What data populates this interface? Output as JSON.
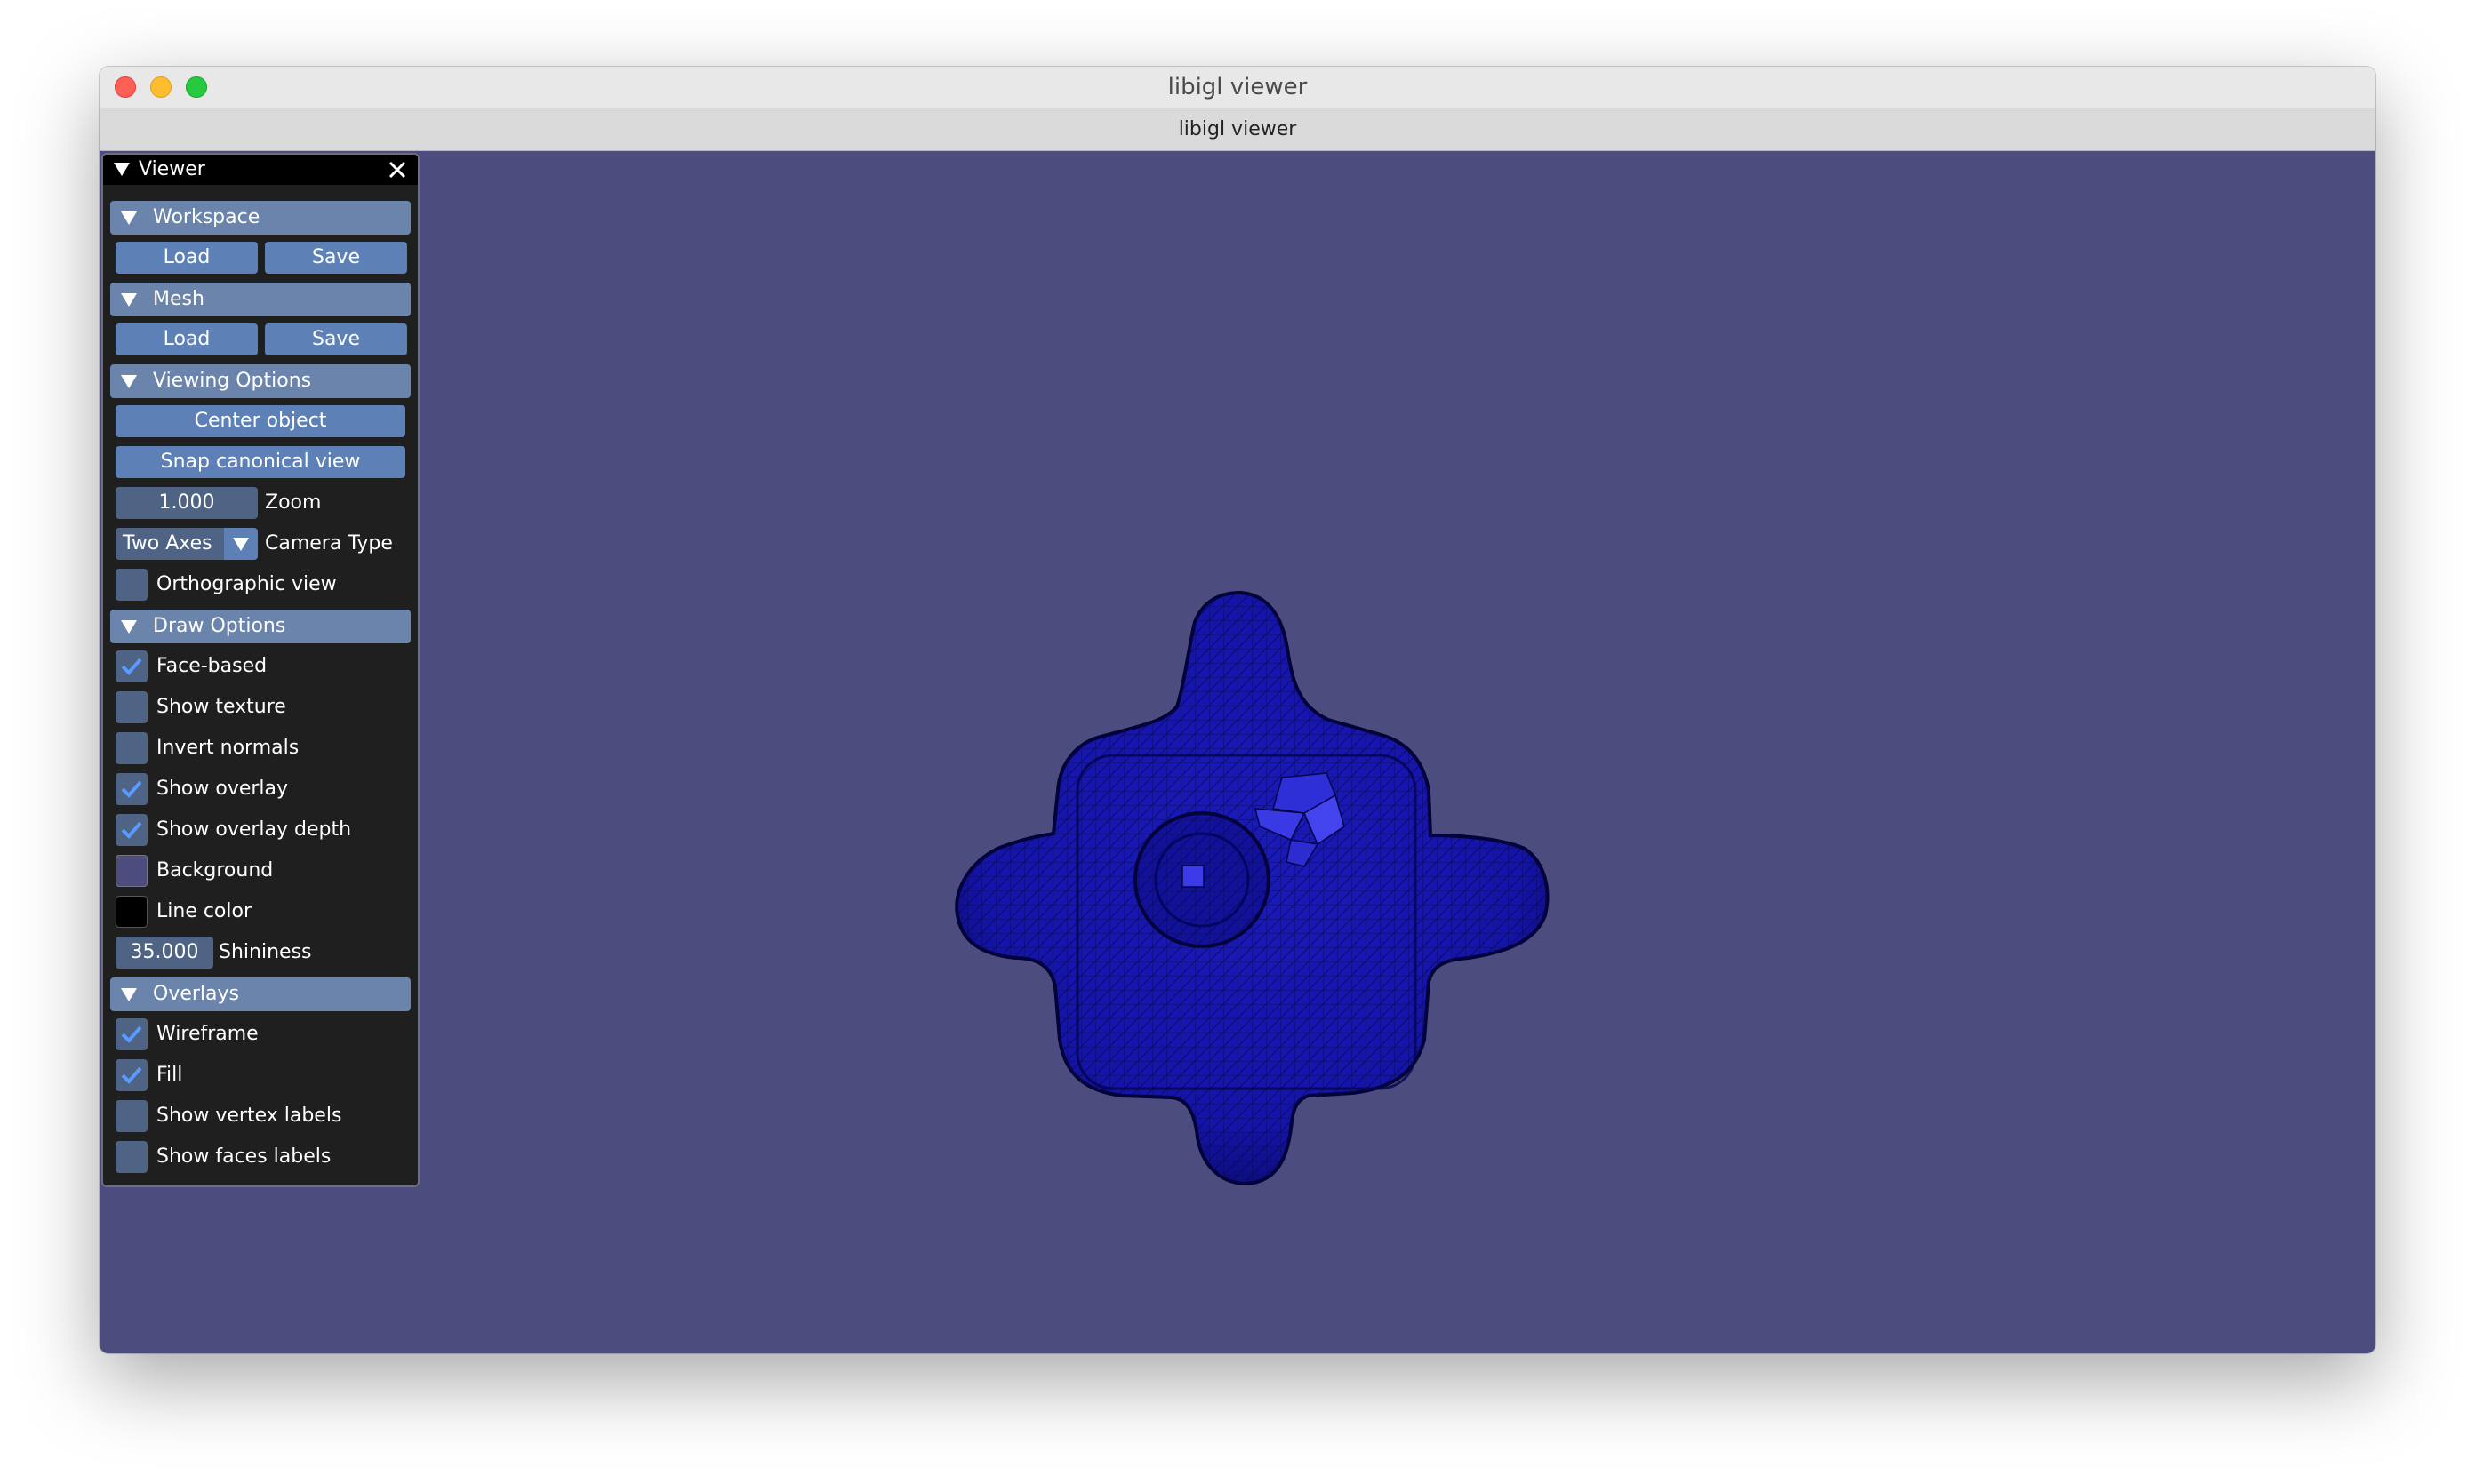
{
  "window": {
    "title": "libigl viewer",
    "tab_title": "libigl viewer"
  },
  "panel": {
    "title": "Viewer",
    "workspace": {
      "header": "Workspace",
      "load": "Load",
      "save": "Save"
    },
    "mesh": {
      "header": "Mesh",
      "load": "Load",
      "save": "Save"
    },
    "viewing": {
      "header": "Viewing Options",
      "center_object": "Center object",
      "snap_view": "Snap canonical view",
      "zoom_value": "1.000",
      "zoom_label": "Zoom",
      "camera_value": "Two Axes",
      "camera_label": "Camera Type",
      "orthographic": {
        "label": "Orthographic view",
        "checked": false
      }
    },
    "draw": {
      "header": "Draw Options",
      "face_based": {
        "label": "Face-based",
        "checked": true
      },
      "show_texture": {
        "label": "Show texture",
        "checked": false
      },
      "invert_normals": {
        "label": "Invert normals",
        "checked": false
      },
      "show_overlay": {
        "label": "Show overlay",
        "checked": true
      },
      "show_overlay_depth": {
        "label": "Show overlay depth",
        "checked": true
      },
      "background": {
        "label": "Background",
        "color": "#4c4c7f"
      },
      "line_color": {
        "label": "Line color",
        "color": "#000000"
      },
      "shininess_value": "35.000",
      "shininess_label": "Shininess"
    },
    "overlays": {
      "header": "Overlays",
      "wireframe": {
        "label": "Wireframe",
        "checked": true
      },
      "fill": {
        "label": "Fill",
        "checked": true
      },
      "vertex_labels": {
        "label": "Show vertex labels",
        "checked": false
      },
      "face_labels": {
        "label": "Show faces labels",
        "checked": false
      }
    }
  },
  "colors": {
    "viewport_bg": "#4c4c7f",
    "mesh_fill": "#1616b4",
    "mesh_highlight": "#3636e0",
    "header_bg": "#6a84ab",
    "button_bg": "#5d80b6",
    "check_mark": "#5b9bff"
  }
}
